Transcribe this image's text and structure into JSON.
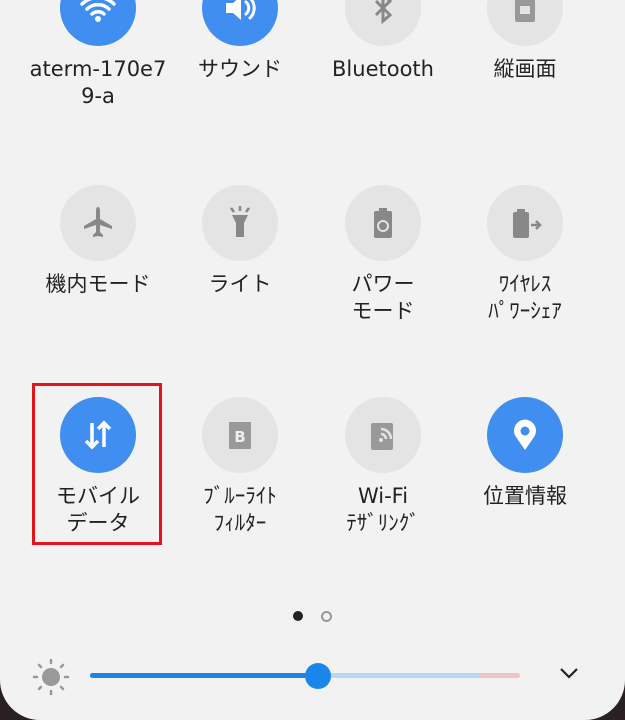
{
  "tiles": [
    {
      "label": "aterm-170e7\n9-a",
      "icon": "wifi-icon",
      "on": true
    },
    {
      "label": "サウンド",
      "icon": "volume-icon",
      "on": true
    },
    {
      "label": "Bluetooth",
      "icon": "bluetooth-icon",
      "on": false
    },
    {
      "label": "縦画面",
      "icon": "portrait-lock-icon",
      "on": false
    },
    {
      "label": "機内モード",
      "icon": "airplane-icon",
      "on": false
    },
    {
      "label": "ライト",
      "icon": "flashlight-icon",
      "on": false
    },
    {
      "label": "パワー\nモード",
      "icon": "power-mode-icon",
      "on": false
    },
    {
      "label": "ﾜｲﾔﾚｽ\nﾊﾟﾜｰｼｪｱ",
      "icon": "wireless-powershare-icon",
      "on": false
    },
    {
      "label": "モバイル\nデータ",
      "icon": "mobile-data-icon",
      "on": true
    },
    {
      "label": "ﾌﾞﾙｰﾗｲﾄ\nﾌｨﾙﾀｰ",
      "icon": "blue-light-filter-icon",
      "on": false
    },
    {
      "label": "Wi-Fi\nﾃｻﾞﾘﾝｸﾞ",
      "icon": "hotspot-icon",
      "on": false
    },
    {
      "label": "位置情報",
      "icon": "location-icon",
      "on": true
    }
  ],
  "page_indicator": {
    "current": 1,
    "total": 2
  },
  "brightness": {
    "level": 0.53
  },
  "colors": {
    "accent": "#3f8ef0",
    "highlight": "#e5141c"
  }
}
